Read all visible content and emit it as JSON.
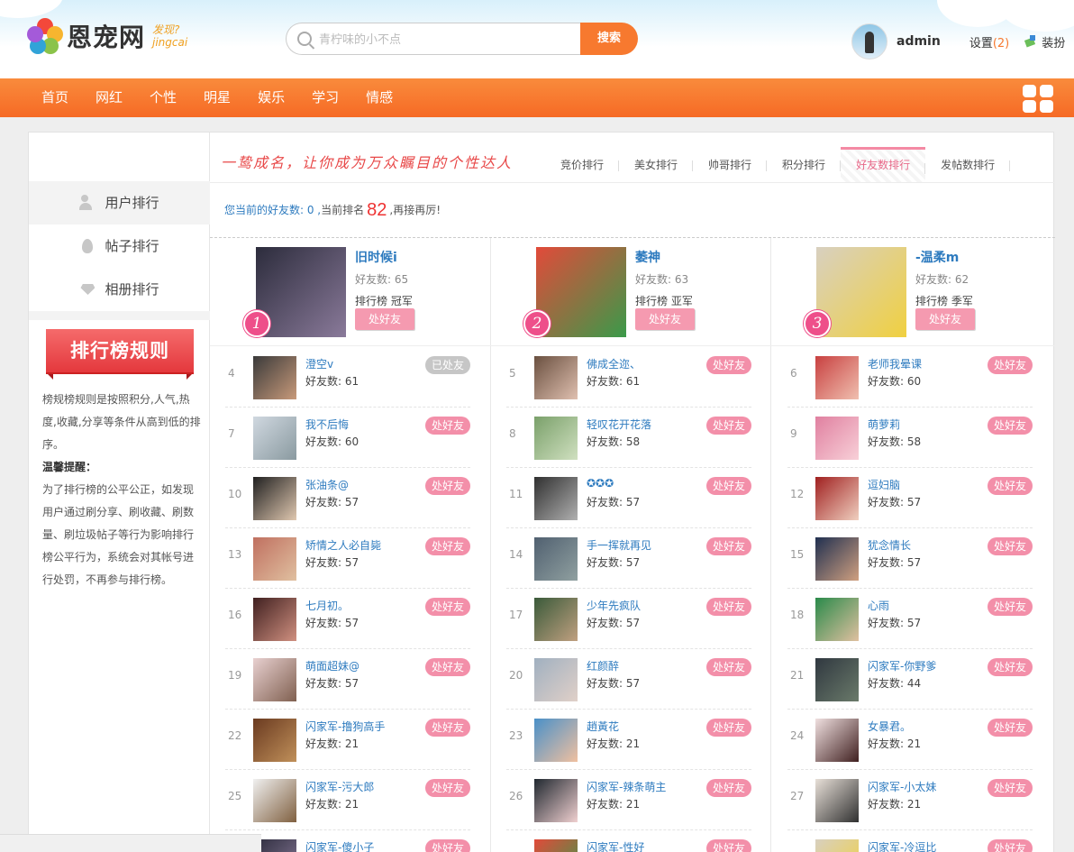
{
  "header": {
    "logo_text": "恩宠网",
    "logo_sub": "发现?",
    "logo_sub2": "jingcai",
    "search_placeholder": "青柠味的小不点",
    "search_button": "搜索",
    "username": "admin",
    "settings_label": "设置",
    "settings_count": "(2)",
    "skin_label": "装扮"
  },
  "nav": {
    "items": [
      "首页",
      "网红",
      "个性",
      "明星",
      "娱乐",
      "学习",
      "情感"
    ]
  },
  "sidebar": {
    "items": [
      {
        "label": "用户排行",
        "icon": "users-icon"
      },
      {
        "label": "帖子排行",
        "icon": "fire-icon"
      },
      {
        "label": "相册排行",
        "icon": "gem-icon"
      }
    ],
    "rule_title": "排行榜规则",
    "rule_text1": "榜规榜规则是按照积分,人气,热度,收藏,分享等条件从高到低的排序。",
    "rule_tip_title": "温馨提醒：",
    "rule_text2": "为了排行榜的公平公正，如发现用户通过刷分享、刷收藏、刷数量、刷垃圾帖子等行为影响排行榜公平行为，系统会对其帐号进行处罚，不再参与排行榜。"
  },
  "content": {
    "slogan": "一鸷成名，让你成为万众瞩目的个性达人",
    "tabs": [
      "竞价排行",
      "美女排行",
      "帅哥排行",
      "积分排行",
      "好友数排行",
      "发帖数排行"
    ],
    "active_tab": 4,
    "my_rank_prefix": "您当前的好友数: 0 ,",
    "my_rank_label": "当前排名",
    "my_rank_num": "82",
    "my_rank_suffix": ",再接再厉!",
    "friend_btn": "处好友",
    "friended_btn": "已处友",
    "top3": [
      {
        "rank": "1",
        "name": "旧时候i",
        "friends": "好友数: 65",
        "title": "排行榜 冠军"
      },
      {
        "rank": "2",
        "name": "萎神",
        "friends": "好友数: 63",
        "title": "排行榜 亚军"
      },
      {
        "rank": "3",
        "name": "-温柔m",
        "friends": "好友数: 62",
        "title": "排行榜 季军"
      }
    ],
    "list": [
      {
        "rank": "4",
        "name": "澄空v",
        "friends": "好友数: 61",
        "done": true
      },
      {
        "rank": "5",
        "name": "佛成全迩、",
        "friends": "好友数: 61"
      },
      {
        "rank": "6",
        "name": "老师我晕课",
        "friends": "好友数: 60"
      },
      {
        "rank": "7",
        "name": "我不后悔",
        "friends": "好友数: 60"
      },
      {
        "rank": "8",
        "name": "轻叹花开花落",
        "friends": "好友数: 58"
      },
      {
        "rank": "9",
        "name": "萌萝莉",
        "friends": "好友数: 58"
      },
      {
        "rank": "10",
        "name": "张油条@",
        "friends": "好友数: 57"
      },
      {
        "rank": "11",
        "name": "✪✪✪",
        "friends": "好友数: 57"
      },
      {
        "rank": "12",
        "name": "逗妇脑",
        "friends": "好友数: 57"
      },
      {
        "rank": "13",
        "name": "矫情之人必自毙",
        "friends": "好友数: 57"
      },
      {
        "rank": "14",
        "name": "手一挥就再见",
        "friends": "好友数: 57"
      },
      {
        "rank": "15",
        "name": "犹念情长",
        "friends": "好友数: 57"
      },
      {
        "rank": "16",
        "name": "七月初。",
        "friends": "好友数: 57"
      },
      {
        "rank": "17",
        "name": "少年先疯队",
        "friends": "好友数: 57"
      },
      {
        "rank": "18",
        "name": "心雨",
        "friends": "好友数: 57"
      },
      {
        "rank": "19",
        "name": "萌面超妹@",
        "friends": "好友数: 57"
      },
      {
        "rank": "20",
        "name": "红颜醉",
        "friends": "好友数: 57"
      },
      {
        "rank": "21",
        "name": "闪家军-你野爹",
        "friends": "好友数: 44"
      },
      {
        "rank": "22",
        "name": "闪家军-撸狗高手",
        "friends": "好友数: 21"
      },
      {
        "rank": "23",
        "name": "趙黃花",
        "friends": "好友数: 21"
      },
      {
        "rank": "24",
        "name": "女暴君。",
        "friends": "好友数: 21"
      },
      {
        "rank": "25",
        "name": "闪家军-污大郎",
        "friends": "好友数: 21"
      },
      {
        "rank": "26",
        "name": "闪家军-辣条萌主",
        "friends": "好友数: 21"
      },
      {
        "rank": "27",
        "name": "闪家军-小太妹",
        "friends": "好友数: 21"
      },
      {
        "rank": "",
        "name": "闪家军-傻小子",
        "friends": ""
      },
      {
        "rank": "",
        "name": "闪家军-性好",
        "friends": ""
      },
      {
        "rank": "",
        "name": "闪家军-冷逗比",
        "friends": ""
      }
    ]
  },
  "colors": {
    "accent_orange": "#f7792f",
    "pink_button": "#f38fa9",
    "link_blue": "#2e7bbf"
  }
}
